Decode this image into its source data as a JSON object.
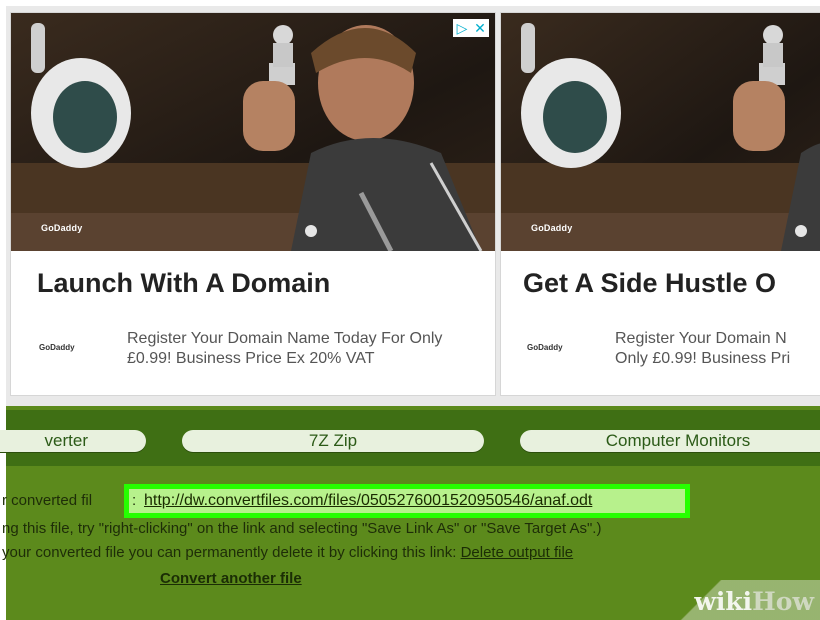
{
  "ads": [
    {
      "headline": "Launch With A Domain",
      "brand": "GoDaddy",
      "description": "Register Your Domain Name Today For Only £0.99! Business Price Ex 20% VAT"
    },
    {
      "headline": "Get A Side Hustle O",
      "brand": "GoDaddy",
      "description_line1": "Register Your Domain N",
      "description_line2": "Only £0.99! Business Pri"
    }
  ],
  "ad_controls": {
    "adchoices_icon": "adchoices-icon",
    "close_icon": "close-icon"
  },
  "nav": {
    "items": [
      "verter",
      "7Z Zip",
      "Computer Monitors"
    ]
  },
  "content": {
    "line1_prefix": "r converted fil",
    "colon": ":",
    "file_url": "http://dw.convertfiles.com/files/0505276001520950546/anaf.odt",
    "line2": "ng this file, try \"right-clicking\" on the link and selecting \"Save Link As\" or \"Save Target As\".)",
    "line3_prefix": "your converted file you can permanently delete it by clicking this link: ",
    "delete_link": "Delete output file",
    "convert_another": "Convert another file"
  },
  "watermark": {
    "part1": "wiki",
    "part2": "How"
  },
  "colors": {
    "site_green": "#5c8a1c",
    "nav_band": "#3f6f14",
    "highlight_border": "#26ff00",
    "adchoices": "#00aecd"
  }
}
